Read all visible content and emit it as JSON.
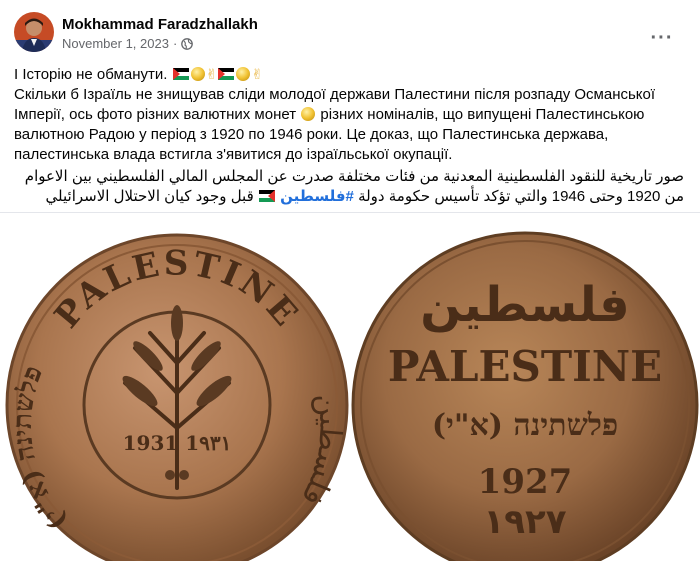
{
  "post": {
    "author": "Mokhammad Faradzhallakh",
    "date": "November 1, 2023",
    "separator": "·",
    "audience_icon": "globe-icon",
    "more_icon": "more-options-icon",
    "more_label": "···"
  },
  "text": {
    "line1": "І Історію не обманути.",
    "ukr_part1": "Скільки б Ізраїль не знищував сліди молодої держави Палестини після розпаду Османської Імперії, ось фото різних валютних монет",
    "ukr_part2": "різних номіналів, що випущені Палестинською валютною Радою у період з 1920 по 1946 роки. Це доказ, що Палестинська держава, палестинська влада встигла з'явитися до ізраїльської окупації.",
    "ar_part1": "صور تاريخية للنقود الفلسطينية المعدنية من فئات مختلفة صدرت عن المجلس المالي الفلسطيني بين الاعوام من 1920 وحتى 1946 والتي تؤكد تأسيس حكومة دولة",
    "hashtag": "#فلسطين",
    "ar_part2": "قبل وجود كيان الاحتلال الاسرائيلي"
  },
  "coins": {
    "left": {
      "legend_top": "PALESTINE",
      "legend_left": "פלשתינה (א\"י)",
      "legend_right": "فلسطين",
      "date": "1931 1٩٣١"
    },
    "right": {
      "arabic": "فلسطين",
      "english": "PALESTINE",
      "hebrew": "פלשתינה (א\"י)",
      "year": "1927",
      "year_arabic": "١٩٢٧"
    }
  },
  "colors": {
    "link": "#216fdb",
    "secondary_text": "#65676b",
    "left_coin": "#a9754e",
    "right_coin": "#9a6a44"
  }
}
